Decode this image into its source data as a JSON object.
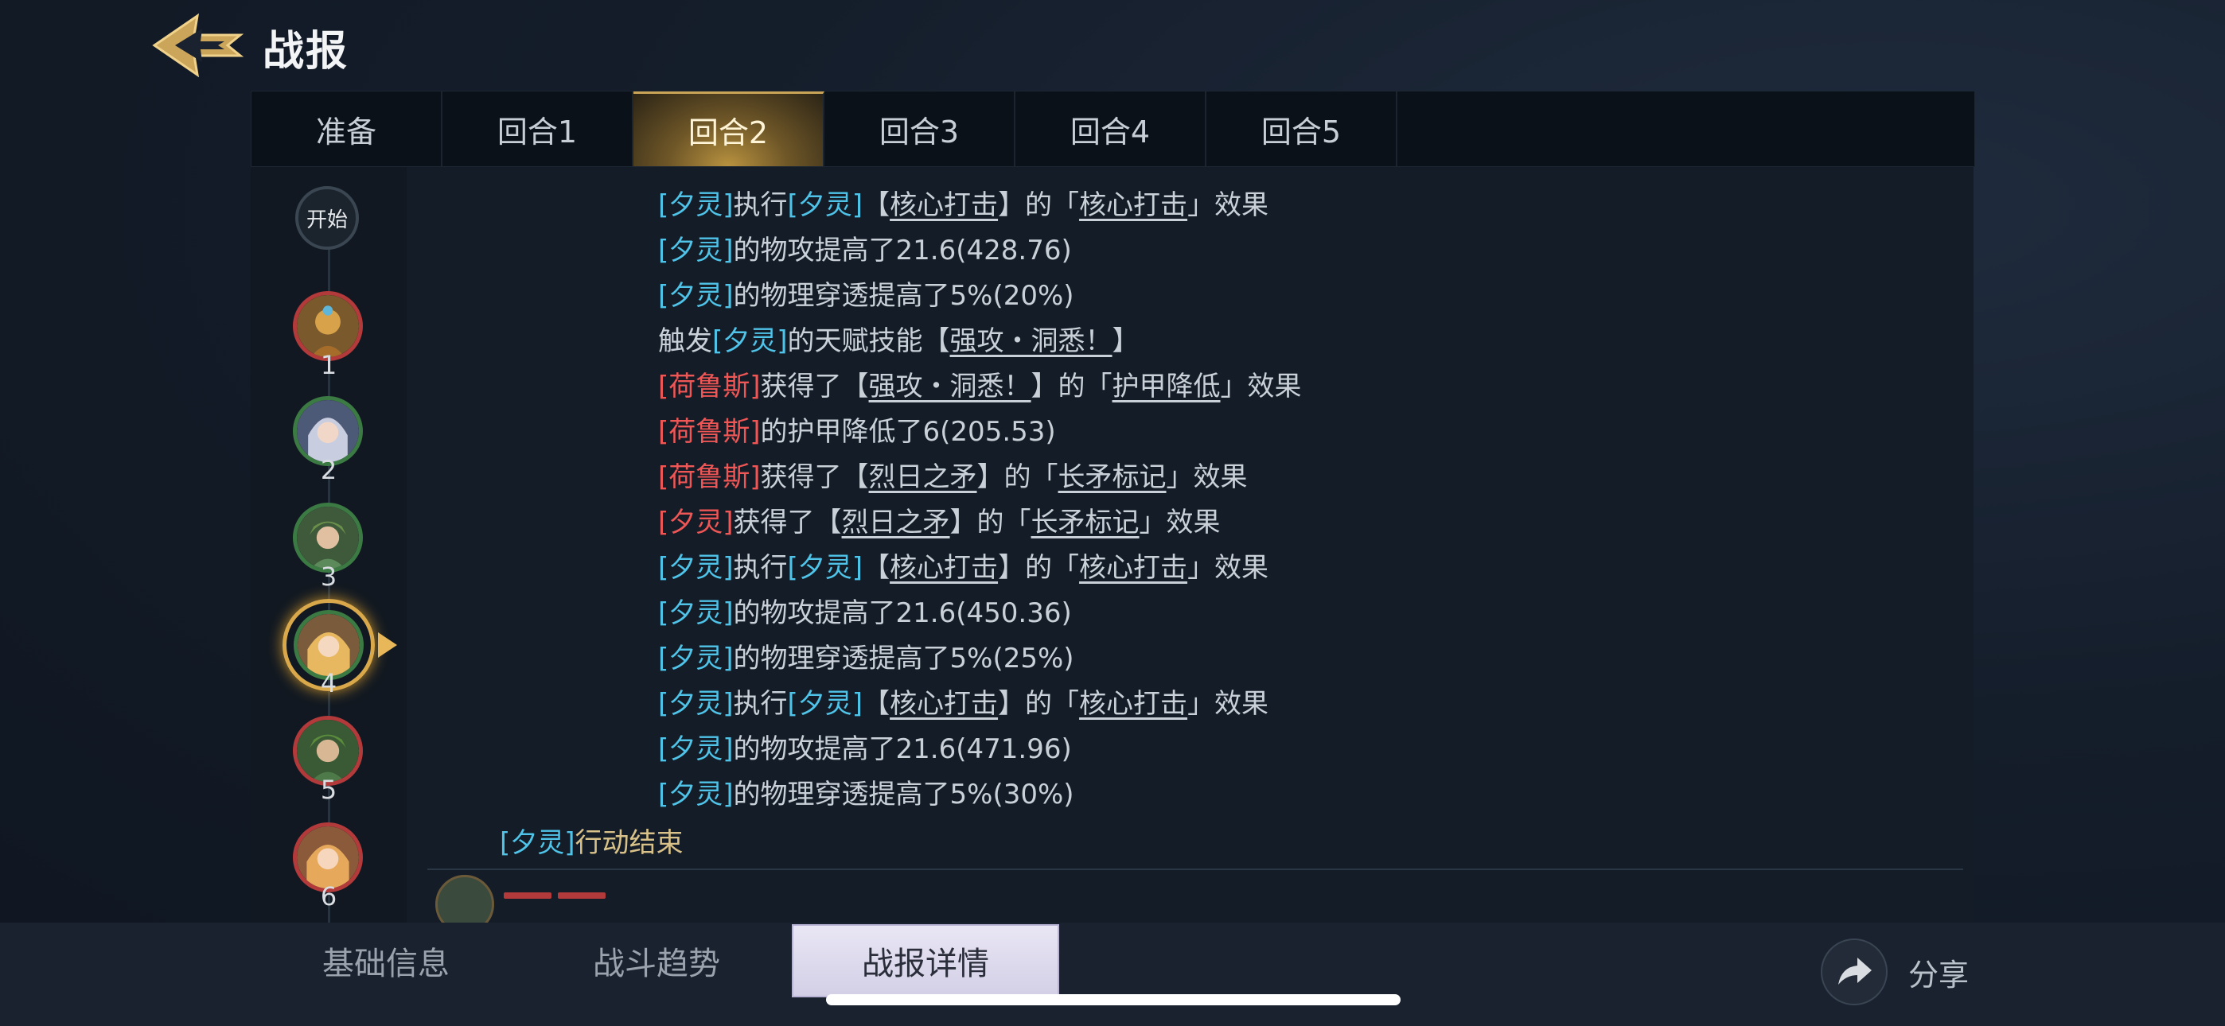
{
  "header": {
    "title": "战报"
  },
  "tabs": [
    "准备",
    "回合1",
    "回合2",
    "回合3",
    "回合4",
    "回合5"
  ],
  "active_tab": "回合2",
  "timeline": {
    "start_label": "开始",
    "avatars": [
      {
        "num": "1",
        "ring": "red"
      },
      {
        "num": "2",
        "ring": "green"
      },
      {
        "num": "3",
        "ring": "green"
      },
      {
        "num": "4",
        "ring": "green",
        "selected": true
      },
      {
        "num": "5",
        "ring": "red"
      },
      {
        "num": "6",
        "ring": "red"
      }
    ]
  },
  "log": {
    "lines": [
      {
        "p1": "[夕灵]",
        "p2": "执行",
        "p3": "[夕灵]",
        "p4": "【",
        "p5": "核心打击",
        "p6": "】的「",
        "p7": "核心打击",
        "p8": "」效果"
      },
      {
        "p1": "[夕灵]",
        "p2": "的物攻提高了21.6(428.76)"
      },
      {
        "p1": "[夕灵]",
        "p2": "的物理穿透提高了5%(20%)"
      },
      {
        "p1": "触发",
        "p2": "[夕灵]",
        "p3": "的天赋技能【",
        "p4": "强攻・洞悉！",
        "p5": "】"
      },
      {
        "p1": "[荷鲁斯]",
        "p2": "获得了【",
        "p3": "强攻・洞悉！",
        "p4": "】的「",
        "p5": "护甲降低",
        "p6": "」效果"
      },
      {
        "p1": "[荷鲁斯]",
        "p2": "的护甲降低了6(205.53)"
      },
      {
        "p1": "[荷鲁斯]",
        "p2": "获得了【",
        "p3": "烈日之矛",
        "p4": "】的「",
        "p5": "长矛标记",
        "p6": "」效果"
      },
      {
        "p1": "[夕灵]",
        "p2": "获得了【",
        "p3": "烈日之矛",
        "p4": "】的「",
        "p5": "长矛标记",
        "p6": "」效果"
      },
      {
        "p1": "[夕灵]",
        "p2": "执行",
        "p3": "[夕灵]",
        "p4": "【",
        "p5": "核心打击",
        "p6": "】的「",
        "p7": "核心打击",
        "p8": "」效果"
      },
      {
        "p1": "[夕灵]",
        "p2": "的物攻提高了21.6(450.36)"
      },
      {
        "p1": "[夕灵]",
        "p2": "的物理穿透提高了5%(25%)"
      },
      {
        "p1": "[夕灵]",
        "p2": "执行",
        "p3": "[夕灵]",
        "p4": "【",
        "p5": "核心打击",
        "p6": "】的「",
        "p7": "核心打击",
        "p8": "」效果"
      },
      {
        "p1": "[夕灵]",
        "p2": "的物攻提高了21.6(471.96)"
      },
      {
        "p1": "[夕灵]",
        "p2": "的物理穿透提高了5%(30%)"
      }
    ],
    "end_line": {
      "p1": "[夕灵]",
      "p2": "行动结束"
    }
  },
  "bottom_tabs": [
    "基础信息",
    "战斗趋势",
    "战报详情"
  ],
  "active_bottom_tab": "战报详情",
  "share_label": "分享",
  "colors": {
    "ally": "#4fc3e8",
    "enemy": "#ef5656",
    "gold": "#c9a456"
  },
  "icons": {
    "back": "chevron-left-winged-icon",
    "share": "share-arrow-icon"
  }
}
